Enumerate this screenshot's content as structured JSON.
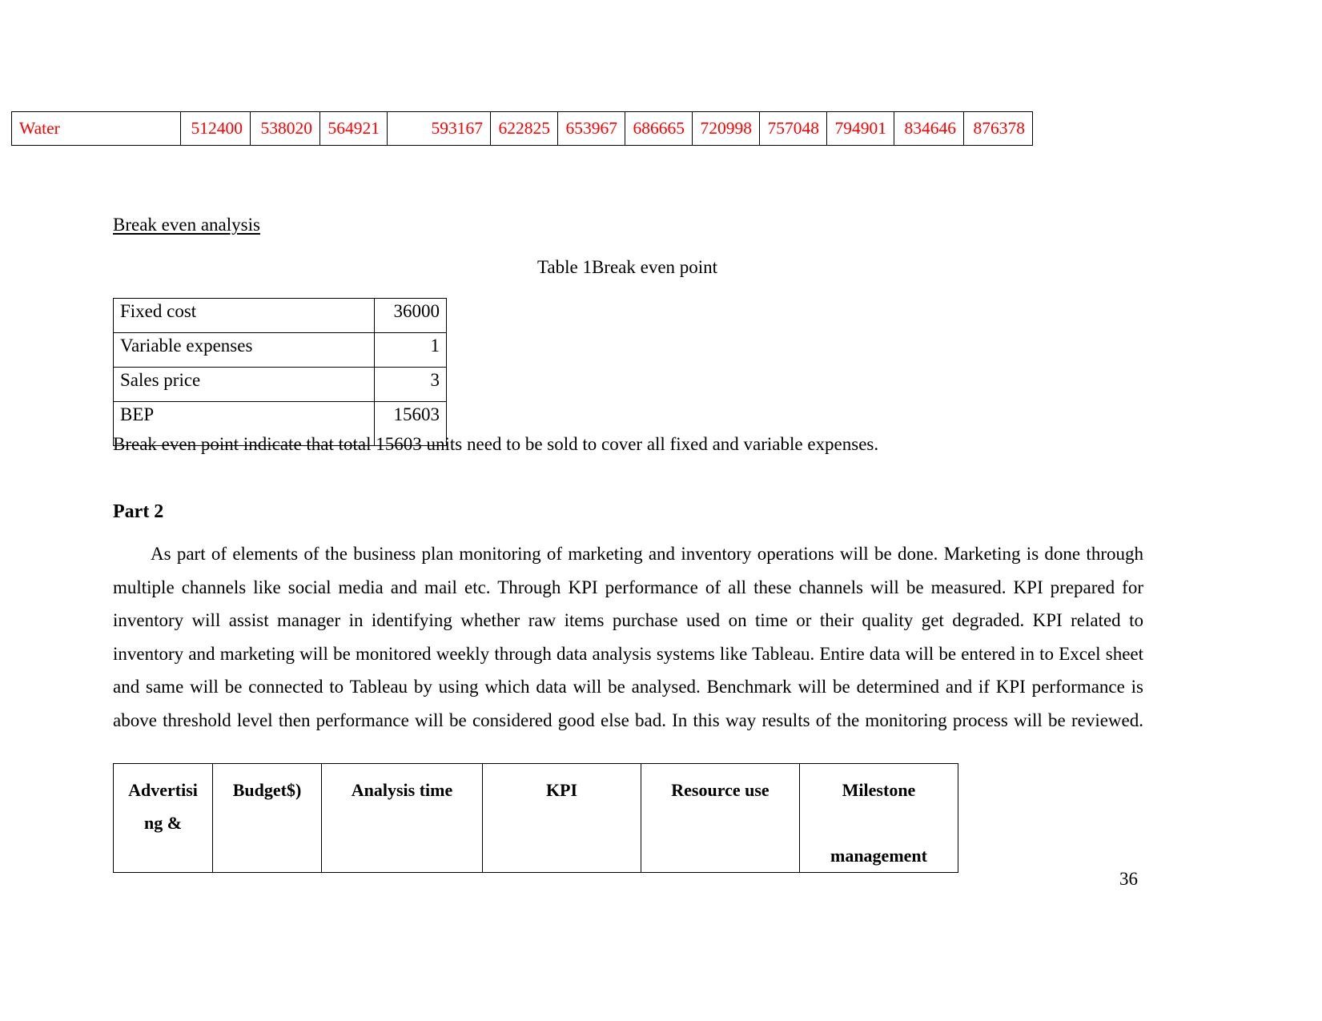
{
  "water_row": {
    "label": "Water",
    "values": [
      "512400",
      "538020",
      "564921",
      "593167",
      "622825",
      "653967",
      "686665",
      "720998",
      "757048",
      "794901",
      "834646",
      "876378"
    ],
    "text_color": "#FF0000"
  },
  "section": {
    "heading": "Break even analysis",
    "table_caption": "Table 1Break even point"
  },
  "bep_table": {
    "rows": [
      {
        "label": "Fixed cost",
        "value": "36000"
      },
      {
        "label": "Variable expenses",
        "value": "1"
      },
      {
        "label": "Sales price",
        "value": "3"
      },
      {
        "label": "BEP",
        "value": "15603"
      }
    ]
  },
  "bep_note": "Break even point indicate that total 15603 units need to be sold to cover all fixed and variable expenses.",
  "part2": {
    "title": "Part 2",
    "paragraph": "As part of elements of the business plan monitoring of marketing and inventory operations will be done. Marketing is done through multiple channels like social media and mail etc. Through KPI performance of all these channels will be measured. KPI prepared for inventory will assist manager in identifying whether raw items purchase used on time or their quality get degraded. KPI related to inventory and marketing will be monitored weekly through data analysis systems like Tableau. Entire data will be entered in to Excel sheet and same will be connected to Tableau by using which data will be analysed. Benchmark will be determined and if KPI performance is above threshold level then performance will be considered good else bad. In this way results of the monitoring process will be reviewed."
  },
  "kpi_table": {
    "headers": [
      "Advertising &",
      "Budget$)",
      "Analysis time",
      "KPI",
      "Resource use",
      "Milestone management"
    ],
    "headers_display": [
      "Advertisi\nng &",
      "Budget$)",
      "Analysis time",
      "KPI",
      "Resource use",
      "Milestone\n\nmanagement"
    ]
  },
  "page_number": "36"
}
